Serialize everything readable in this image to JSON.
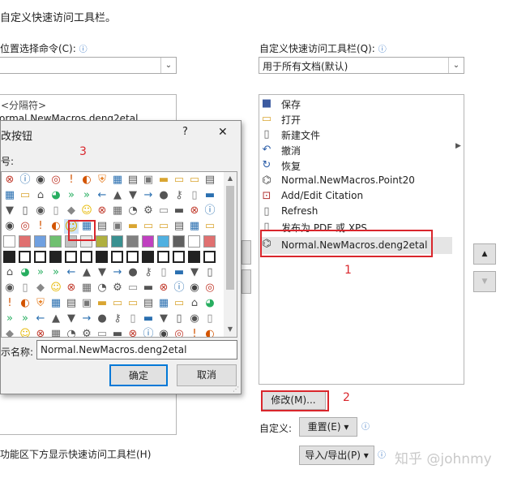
{
  "header": {
    "title": "自定义快速访问工具栏。"
  },
  "left": {
    "choose_label": "位置选择命令(C):",
    "choose_value": "",
    "list_first": "<分隔符>",
    "list_second": "ormal.NewMacros.deng2etal",
    "show_below_label": "功能区下方显示快速访问工具栏(H)"
  },
  "right": {
    "customize_label": "自定义快速访问工具栏(Q):",
    "customize_value": "用于所有文档(默认)",
    "items": [
      {
        "label": "保存",
        "icon": "save-icon",
        "glyph": "■",
        "color": "#3b5aa0"
      },
      {
        "label": "打开",
        "icon": "folder-open-icon",
        "glyph": "▭",
        "color": "#d9a531"
      },
      {
        "label": "新建文件",
        "icon": "new-file-icon",
        "glyph": "▯",
        "color": "#666666"
      },
      {
        "label": "撤消",
        "icon": "undo-icon",
        "glyph": "↶",
        "color": "#2c5ea8"
      },
      {
        "label": "恢复",
        "icon": "redo-icon",
        "glyph": "↻",
        "color": "#2c5ea8"
      },
      {
        "label": "Normal.NewMacros.Point20",
        "icon": "macro-icon",
        "glyph": "⌬",
        "color": "#444444"
      },
      {
        "label": "Add/Edit Citation",
        "icon": "citation-icon",
        "glyph": "⊡",
        "color": "#b03030"
      },
      {
        "label": "Refresh",
        "icon": "refresh-icon",
        "glyph": "▯",
        "color": "#666666"
      },
      {
        "label": "发布为 PDF 或 XPS",
        "icon": "pdf-icon",
        "glyph": "▯",
        "color": "#666666"
      },
      {
        "label": "Normal.NewMacros.deng2etal",
        "icon": "macro-icon",
        "glyph": "⌬",
        "color": "#444444"
      }
    ],
    "modify_button": "修改(M)...",
    "customize_row_label": "自定义:",
    "reset_button": "重置(E) ▾",
    "import_export_button": "导入/导出(P) ▾",
    "move_up": "▲",
    "move_down": "▼"
  },
  "dialog": {
    "title": "改按钮",
    "help": "?",
    "close": "✕",
    "symbol_label": "号:",
    "display_name_label": "示名称:",
    "display_name_value": "Normal.NewMacros.deng2etal",
    "ok_button": "确定",
    "cancel_button": "取消"
  },
  "annotations": {
    "n1": "1",
    "n2": "2",
    "n3": "3"
  },
  "watermark": "知乎 @johnmy",
  "colors": {
    "accent_red": "#d9262c",
    "selection": "#e5e5e5",
    "ok_border": "#0078d7"
  }
}
